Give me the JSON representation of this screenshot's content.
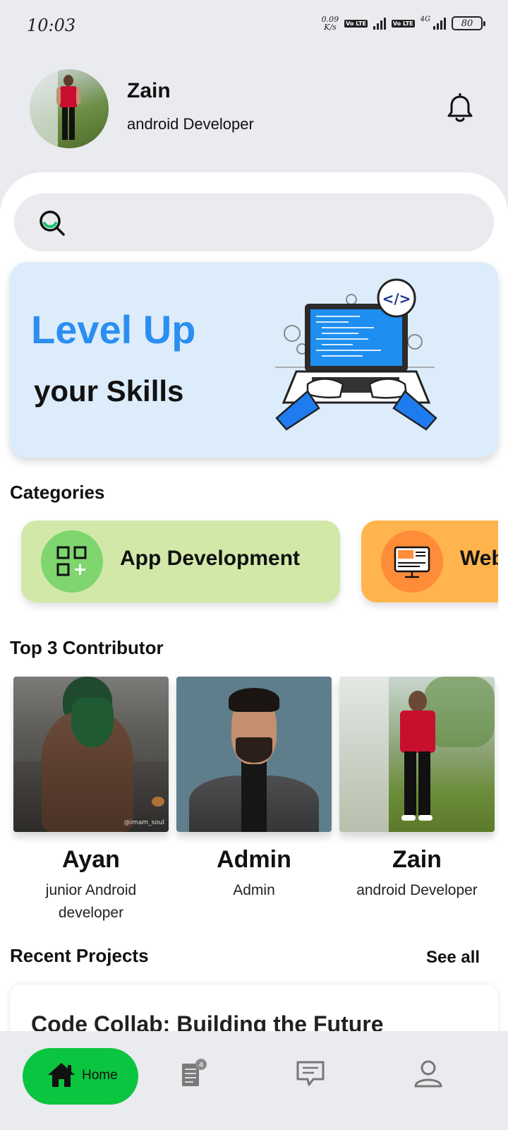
{
  "status_bar": {
    "time": "10:03",
    "net_speed_value": "0.09",
    "net_speed_unit": "K/s",
    "volte_label": "Vo LTE",
    "network_type": "4G",
    "battery": "80"
  },
  "header": {
    "user_name": "Zain",
    "user_role": "android Developer"
  },
  "search": {
    "placeholder": ""
  },
  "banner": {
    "line1": "Level Up",
    "line2": "your Skills",
    "code_tag": "</>"
  },
  "categories": {
    "title": "Categories",
    "items": [
      {
        "label": "App Development",
        "icon": "grid-plus-icon",
        "color": "#d2e8a8"
      },
      {
        "label": "Web Development",
        "icon": "monitor-code-icon",
        "color": "#ffb44d"
      }
    ]
  },
  "contributors": {
    "title": "Top 3 Contributor",
    "items": [
      {
        "name": "Ayan",
        "role": "junior Android developer",
        "watermark": "@imam_soul"
      },
      {
        "name": "Admin",
        "role": "Admin"
      },
      {
        "name": "Zain",
        "role": "android Developer"
      }
    ]
  },
  "recent_projects": {
    "title": "Recent Projects",
    "see_all": "See all",
    "items": [
      {
        "title": "Code Collab: Building the Future"
      }
    ]
  },
  "bottom_nav": {
    "home_label": "Home",
    "tasks_badge": "4",
    "colors": {
      "active": "#0bc440"
    }
  }
}
